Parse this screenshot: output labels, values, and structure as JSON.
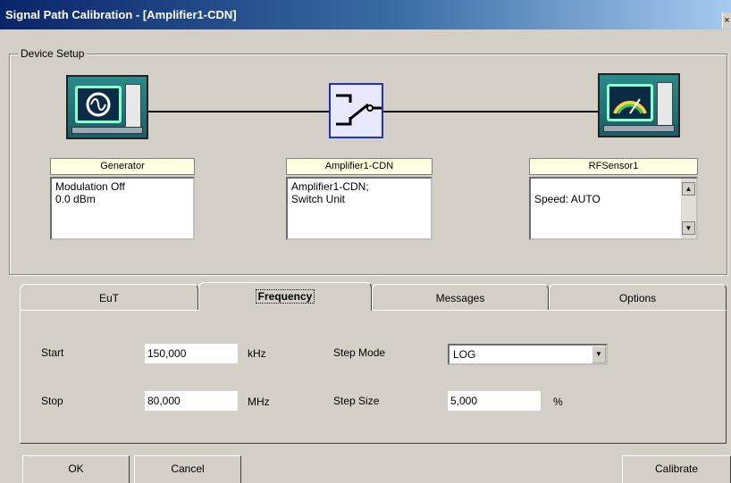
{
  "window": {
    "title": "Signal Path Calibration - [Amplifier1-CDN]",
    "close_glyph": "×"
  },
  "device_setup": {
    "label": "Device Setup",
    "devices": [
      {
        "name": "Generator",
        "text": "Modulation Off\n0.0 dBm",
        "icon": "signal-generator-icon"
      },
      {
        "name": "Amplifier1-CDN",
        "text": "Amplifier1-CDN;\nSwitch Unit",
        "icon": "switch-icon"
      },
      {
        "name": "RFSensor1",
        "text": "Speed: AUTO",
        "icon": "rf-sensor-icon"
      }
    ]
  },
  "tabs": [
    {
      "label": "EuT",
      "active": false
    },
    {
      "label": "Frequency",
      "active": true
    },
    {
      "label": "Messages",
      "active": false
    },
    {
      "label": "Options",
      "active": false
    }
  ],
  "frequency": {
    "start_label": "Start",
    "start_value": "150,000",
    "start_unit": "kHz",
    "stop_label": "Stop",
    "stop_value": "80,000",
    "stop_unit": "MHz",
    "step_mode_label": "Step Mode",
    "step_mode_value": "LOG",
    "step_size_label": "Step Size",
    "step_size_value": "5,000",
    "step_size_unit": "%"
  },
  "buttons": {
    "ok": "OK",
    "cancel": "Cancel",
    "calibrate": "Calibrate"
  }
}
